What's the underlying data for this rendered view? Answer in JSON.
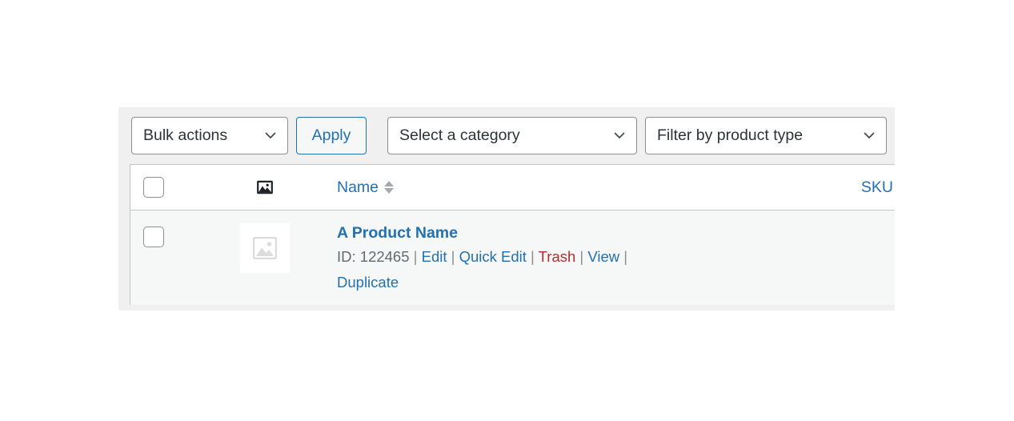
{
  "toolbar": {
    "bulk_actions": {
      "label": "Bulk actions",
      "icon": "chevron-down-icon"
    },
    "apply": {
      "label": "Apply"
    },
    "category": {
      "label": "Select a category",
      "icon": "chevron-down-icon"
    },
    "product_type": {
      "label": "Filter by product type",
      "icon": "chevron-down-icon"
    }
  },
  "table": {
    "columns": [
      {
        "key": "cb",
        "label": "",
        "icon": "checkbox-icon"
      },
      {
        "key": "thumb",
        "label": "",
        "icon": "image-icon"
      },
      {
        "key": "name",
        "label": "Name",
        "sortable": true
      },
      {
        "key": "sku",
        "label": "SKU",
        "sortable": true
      }
    ],
    "rows": [
      {
        "title": "A Product Name",
        "id_text": "ID: 122465",
        "actions": [
          {
            "label": "Edit",
            "style": "link"
          },
          {
            "label": "Quick Edit",
            "style": "link"
          },
          {
            "label": "Trash",
            "style": "danger"
          },
          {
            "label": "View",
            "style": "link"
          },
          {
            "label": "Duplicate",
            "style": "link"
          }
        ],
        "separator": "|",
        "sku": "–",
        "thumbnail_icon": "image-placeholder-icon"
      }
    ]
  },
  "colors": {
    "link": "#2271b1",
    "danger": "#b32d2e",
    "toolbar_bg": "#f0f0f1",
    "row_bg": "#f6f7f7",
    "border": "#c3c4c7"
  }
}
